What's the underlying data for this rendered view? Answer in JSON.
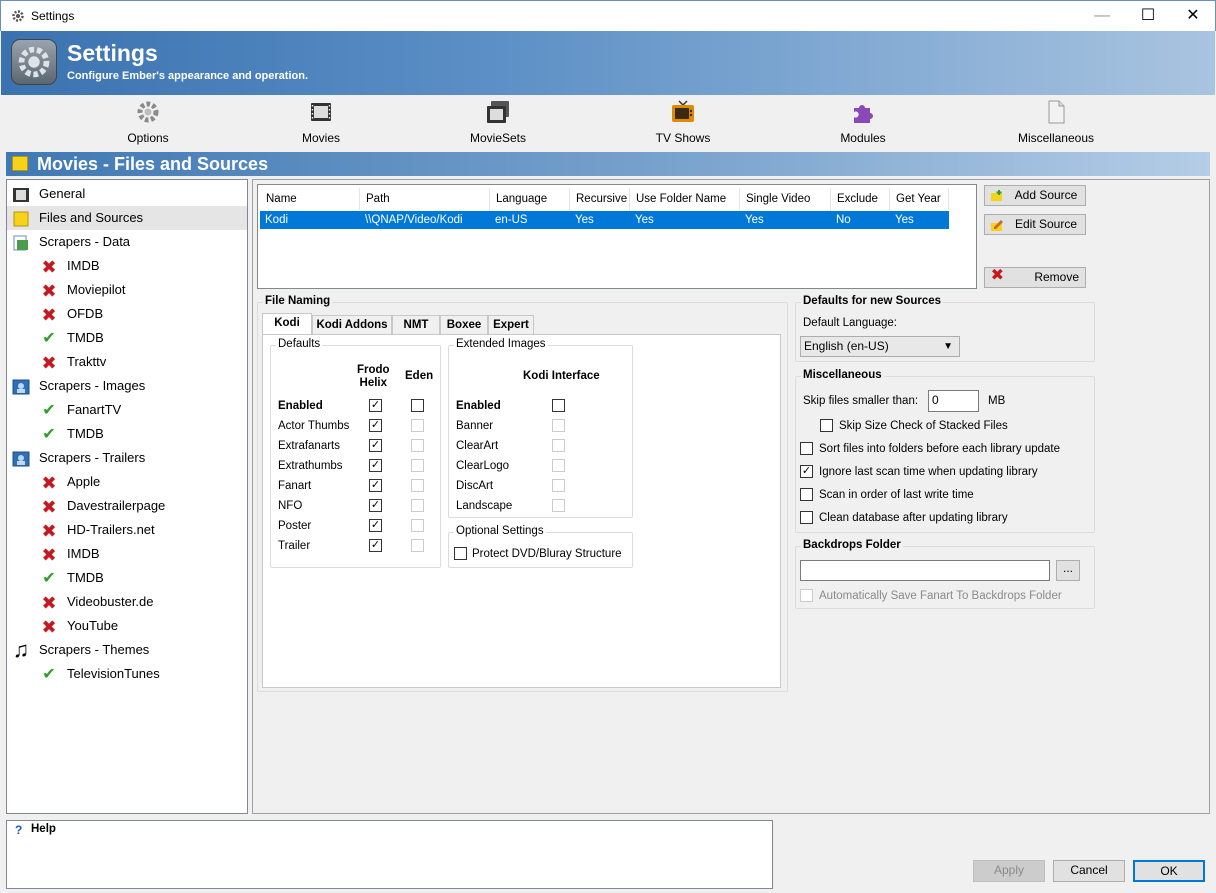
{
  "window": {
    "title": "Settings",
    "minimize": "—",
    "maximize": "☐",
    "close": "✕"
  },
  "banner": {
    "title": "Settings",
    "subtitle": "Configure Ember's appearance and operation."
  },
  "toolbar": [
    {
      "label": "Options",
      "icon": "gear-icon"
    },
    {
      "label": "Movies",
      "icon": "film-icon"
    },
    {
      "label": "MovieSets",
      "icon": "film-stack-icon"
    },
    {
      "label": "TV Shows",
      "icon": "tv-icon"
    },
    {
      "label": "Modules",
      "icon": "puzzle-icon"
    },
    {
      "label": "Miscellaneous",
      "icon": "document-icon"
    }
  ],
  "section": {
    "title": "Movies - Files and Sources"
  },
  "tree": [
    {
      "label": "General",
      "icon": "film-icon"
    },
    {
      "label": "Files and Sources",
      "icon": "folder-icon",
      "selected": true
    },
    {
      "label": "Scrapers - Data",
      "icon": "data-icon"
    },
    {
      "label": "IMDB",
      "icon": "x-icon"
    },
    {
      "label": "Moviepilot",
      "icon": "x-icon"
    },
    {
      "label": "OFDB",
      "icon": "x-icon"
    },
    {
      "label": "TMDB",
      "icon": "check-icon"
    },
    {
      "label": "Trakttv",
      "icon": "x-icon"
    },
    {
      "label": "Scrapers - Images",
      "icon": "image-icon"
    },
    {
      "label": "FanartTV",
      "icon": "check-icon"
    },
    {
      "label": "TMDB",
      "icon": "check-icon"
    },
    {
      "label": "Scrapers - Trailers",
      "icon": "image-icon"
    },
    {
      "label": "Apple",
      "icon": "x-icon"
    },
    {
      "label": "Davestrailerpage",
      "icon": "x-icon"
    },
    {
      "label": "HD-Trailers.net",
      "icon": "x-icon"
    },
    {
      "label": "IMDB",
      "icon": "x-icon"
    },
    {
      "label": "TMDB",
      "icon": "check-icon"
    },
    {
      "label": "Videobuster.de",
      "icon": "x-icon"
    },
    {
      "label": "YouTube",
      "icon": "x-icon"
    },
    {
      "label": "Scrapers - Themes",
      "icon": "music-icon"
    },
    {
      "label": "TelevisionTunes",
      "icon": "check-icon"
    }
  ],
  "sources": {
    "columns": [
      "Name",
      "Path",
      "Language",
      "Recursive",
      "Use Folder Name",
      "Single Video",
      "Exclude",
      "Get Year"
    ],
    "rows": [
      [
        "Kodi",
        "\\\\QNAP/Video/Kodi",
        "en-US",
        "Yes",
        "Yes",
        "Yes",
        "No",
        "Yes"
      ]
    ]
  },
  "buttons": {
    "add_source": "Add Source",
    "edit_source": "Edit Source",
    "remove": "Remove",
    "apply": "Apply",
    "cancel": "Cancel",
    "ok": "OK",
    "browse": "..."
  },
  "file_naming": {
    "title": "File Naming",
    "tabs": [
      "Kodi",
      "Kodi Addons",
      "NMT",
      "Boxee",
      "Expert"
    ],
    "defaults": {
      "title": "Defaults",
      "col1": "Frodo\nHelix",
      "col2": "Eden",
      "rows": [
        {
          "label": "Enabled",
          "frodo": true,
          "eden": false
        },
        {
          "label": "Actor Thumbs",
          "frodo": true,
          "eden": false
        },
        {
          "label": "Extrafanarts",
          "frodo": true,
          "eden": false
        },
        {
          "label": "Extrathumbs",
          "frodo": true,
          "eden": false
        },
        {
          "label": "Fanart",
          "frodo": true,
          "eden": false
        },
        {
          "label": "NFO",
          "frodo": true,
          "eden": false
        },
        {
          "label": "Poster",
          "frodo": true,
          "eden": false
        },
        {
          "label": "Trailer",
          "frodo": true,
          "eden": false
        }
      ]
    },
    "extended": {
      "title": "Extended Images",
      "col": "Kodi Interface",
      "rows": [
        "Enabled",
        "Banner",
        "ClearArt",
        "ClearLogo",
        "DiscArt",
        "Landscape"
      ]
    },
    "optional": {
      "title": "Optional Settings",
      "protect": "Protect DVD/Bluray Structure"
    }
  },
  "defaults_new": {
    "title": "Defaults for new Sources",
    "lang_label": "Default Language:",
    "lang_value": "English (en-US)"
  },
  "misc": {
    "title": "Miscellaneous",
    "skip_label": "Skip files smaller than:",
    "skip_value": "0",
    "skip_unit": "MB",
    "skip_stacked": "Skip Size Check of Stacked Files",
    "sort": "Sort files into folders before each library update",
    "ignore": "Ignore last scan time when updating library",
    "scan_order": "Scan in order of last write time",
    "clean": "Clean database after updating library"
  },
  "backdrops": {
    "title": "Backdrops Folder",
    "auto_save": "Automatically Save Fanart To Backdrops Folder"
  },
  "help": {
    "title": "Help",
    "icon": "question-icon"
  }
}
